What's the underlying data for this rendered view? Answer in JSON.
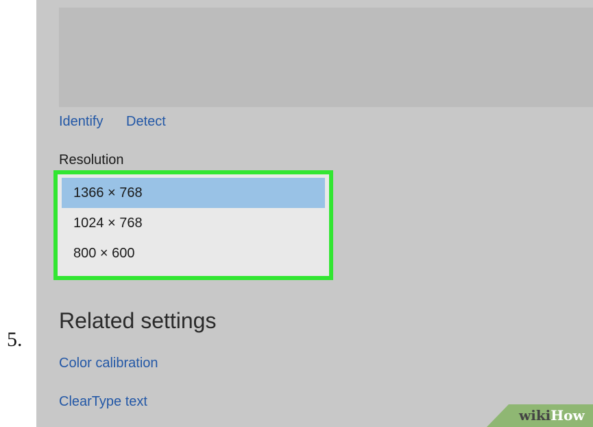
{
  "step": {
    "number": "5."
  },
  "display": {
    "links": {
      "identify": "Identify",
      "detect": "Detect"
    },
    "resolution": {
      "label": "Resolution",
      "options": [
        "1366 × 768",
        "1024 × 768",
        "800 × 600"
      ],
      "selected": "1366 × 768"
    }
  },
  "related": {
    "heading": "Related settings",
    "links": [
      "Color calibration",
      "ClearType text"
    ]
  },
  "watermark": {
    "wiki": "wiki",
    "how": "How"
  },
  "colors": {
    "link": "#2257a6",
    "highlight_border": "#32e632",
    "selected_option": "#99c2e6",
    "background": "#c8c8c8",
    "watermark_green": "#8fb773"
  }
}
